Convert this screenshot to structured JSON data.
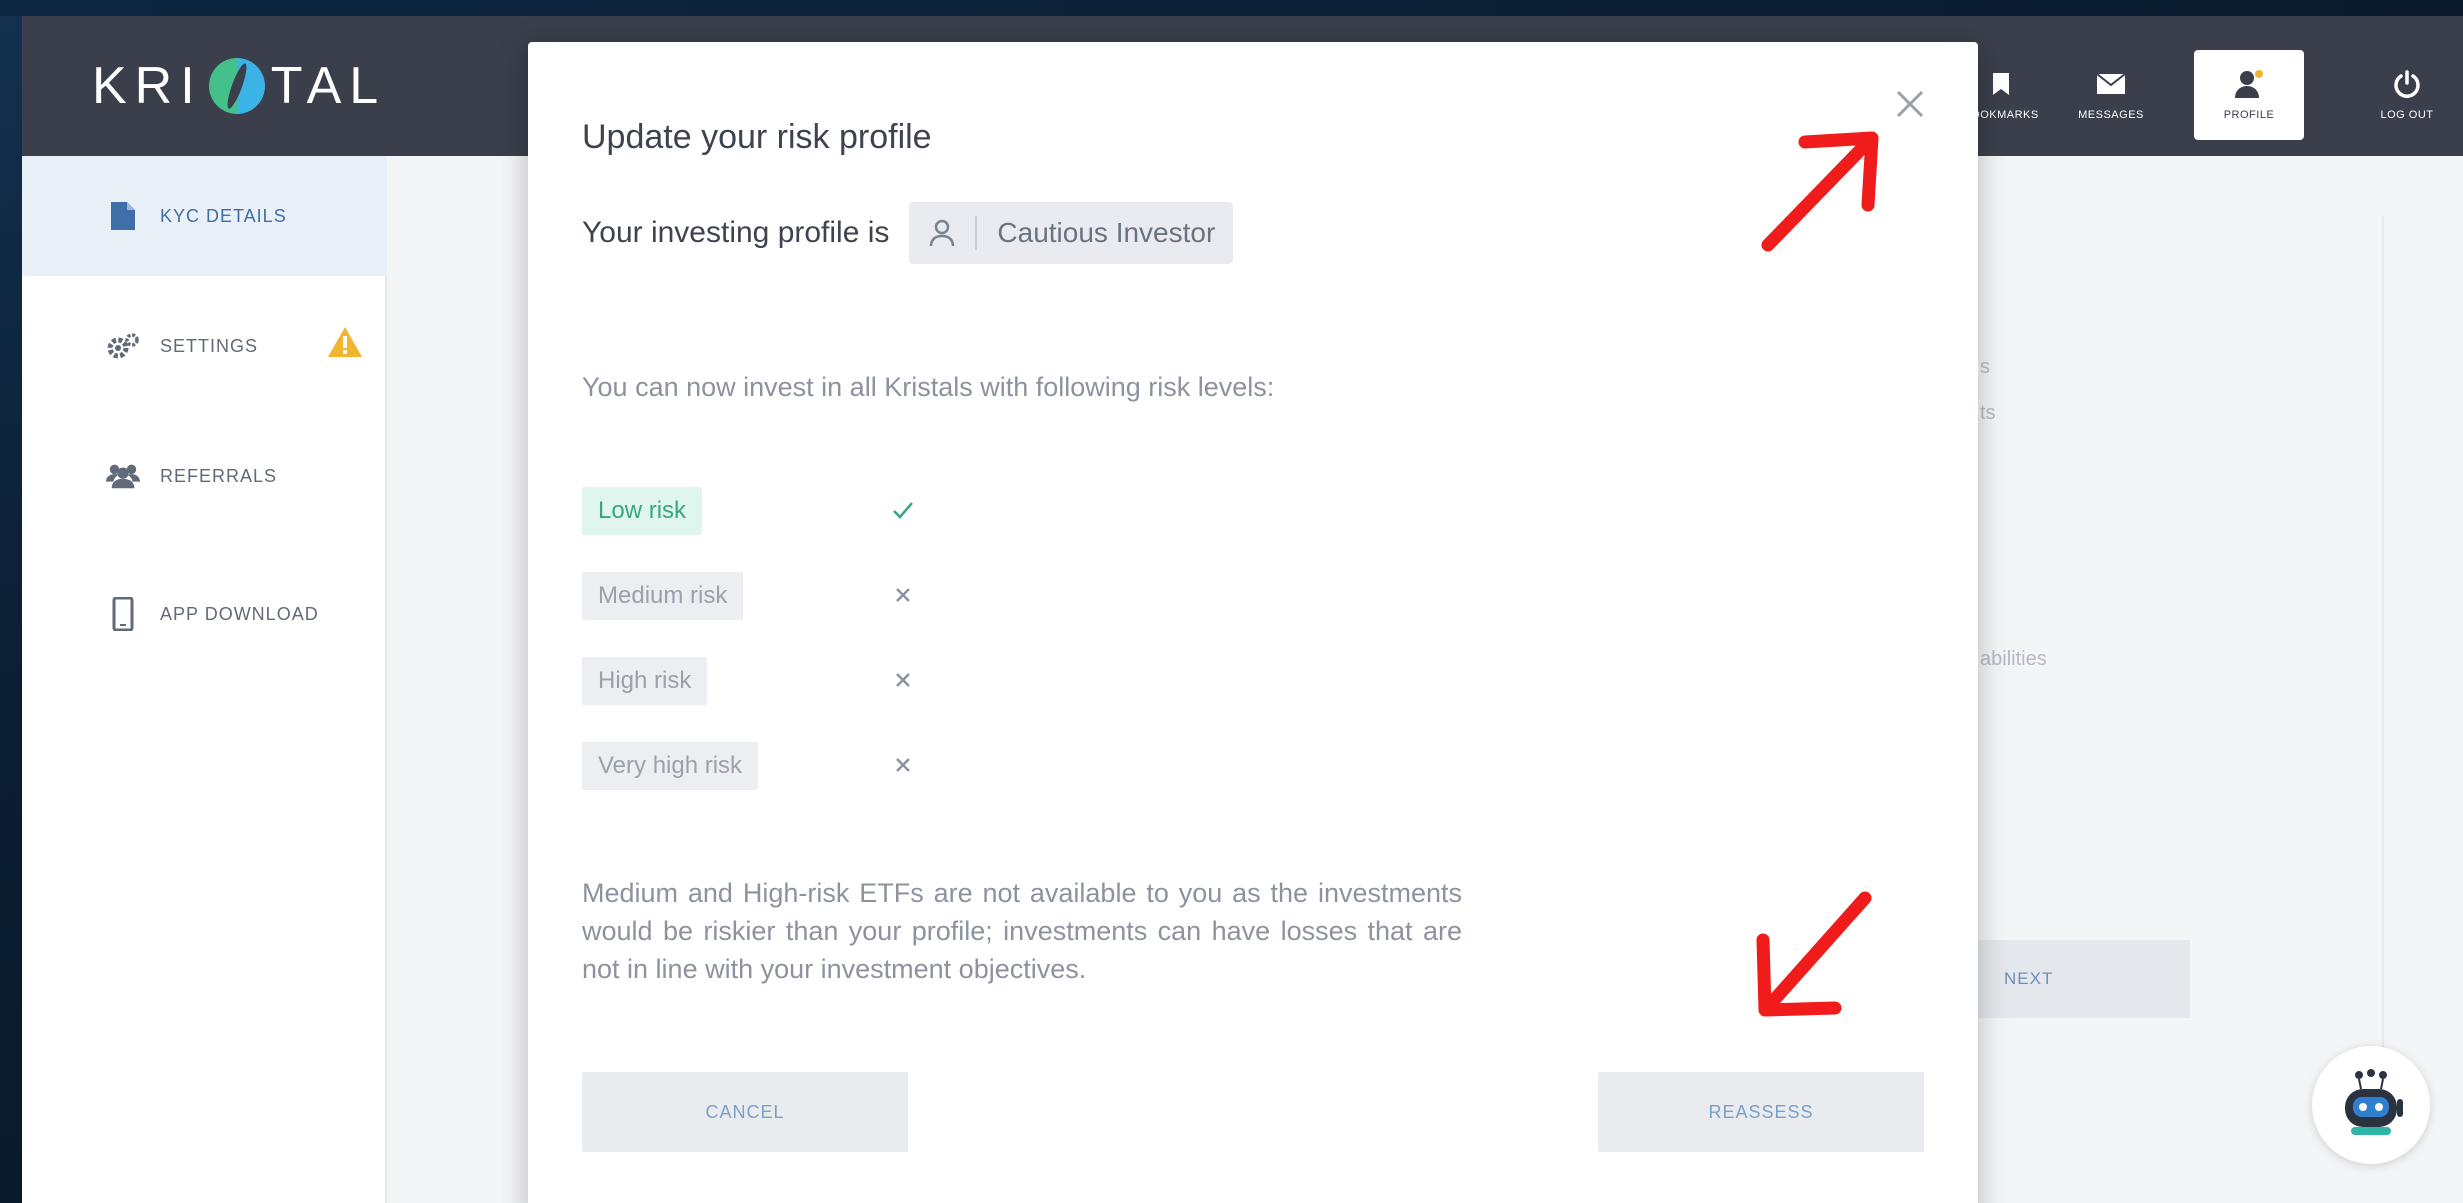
{
  "app": {
    "logo_left": "KRI",
    "logo_right": "TAL"
  },
  "navbar": {
    "items": [
      {
        "label": "BOOKMARKS",
        "icon": "bookmark-icon"
      },
      {
        "label": "MESSAGES",
        "icon": "envelope-icon"
      },
      {
        "label": "PROFILE",
        "icon": "user-icon",
        "active": true
      },
      {
        "label": "LOG OUT",
        "icon": "power-icon"
      }
    ]
  },
  "sidebar": {
    "items": [
      {
        "label": "KYC DETAILS",
        "icon": "document-icon",
        "active": true
      },
      {
        "label": "SETTINGS",
        "icon": "gears-icon",
        "warning": true
      },
      {
        "label": "REFERRALS",
        "icon": "users-icon"
      },
      {
        "label": "APP DOWNLOAD",
        "icon": "phone-icon"
      }
    ]
  },
  "background_page": {
    "fragments": [
      "s",
      "ts",
      "abilities"
    ],
    "next_label": "NEXT"
  },
  "modal": {
    "title": "Update your risk profile",
    "profile_label": "Your investing profile is",
    "profile_value": "Cautious Investor",
    "invest_message": "You can now invest in all Kristals with following risk levels:",
    "risk_levels": [
      {
        "label": "Low risk",
        "allowed": true
      },
      {
        "label": "Medium risk",
        "allowed": false
      },
      {
        "label": "High risk",
        "allowed": false
      },
      {
        "label": "Very high risk",
        "allowed": false
      }
    ],
    "note": "Medium and High-risk ETFs are not available to you as the investments would be riskier than your profile; investments can have losses that are not in line with your investment objectives.",
    "cancel_label": "CANCEL",
    "reassess_label": "REASSESS"
  },
  "colors": {
    "navbar": "#3a3f4b",
    "accent_blue": "#3f6ea8",
    "ok_green": "#3aa584",
    "warning": "#f2b530",
    "annotation_red": "#f01b1b"
  }
}
